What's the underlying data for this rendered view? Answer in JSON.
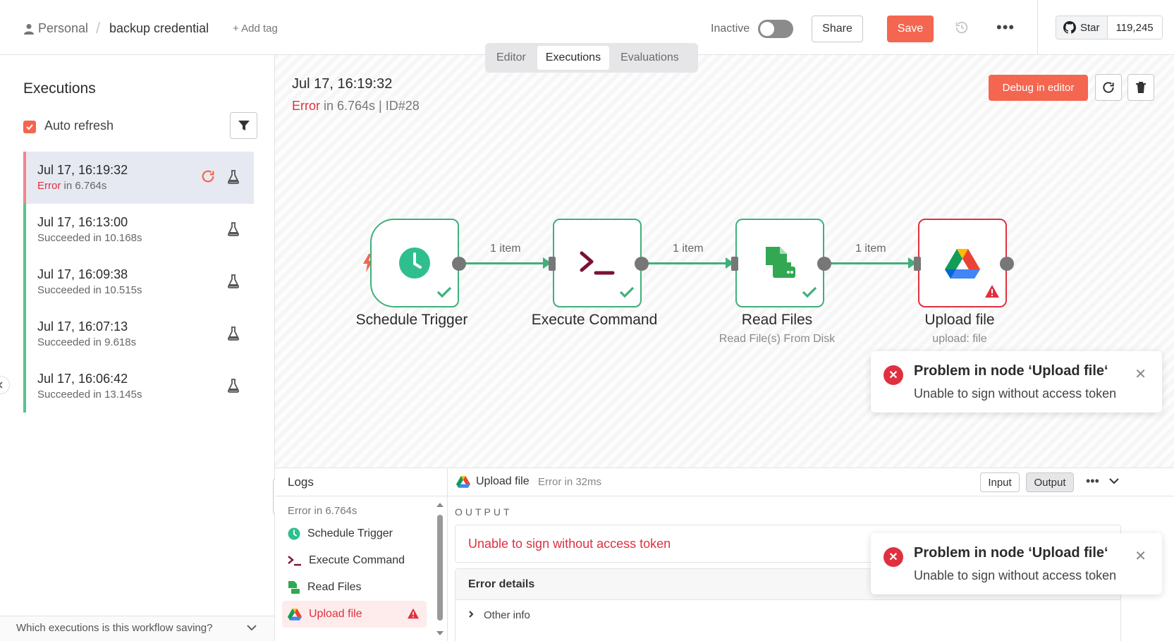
{
  "header": {
    "breadcrumb_owner": "Personal",
    "breadcrumb_sep": "/",
    "workflow_name": "backup credential",
    "add_tag": "+ Add tag",
    "active_label": "Inactive",
    "share_label": "Share",
    "save_label": "Save",
    "more_label": "•••",
    "github_star_label": "Star",
    "github_star_count": "119,245"
  },
  "tabs": [
    {
      "label": "Editor"
    },
    {
      "label": "Executions"
    },
    {
      "label": "Evaluations"
    }
  ],
  "sidebar": {
    "title": "Executions",
    "auto_refresh_label": "Auto refresh",
    "executions": [
      {
        "time": "Jul 17, 16:19:32",
        "status": "Error",
        "duration": " in 6.764s"
      },
      {
        "time": "Jul 17, 16:13:00",
        "status": "Succeeded in 10.168s"
      },
      {
        "time": "Jul 17, 16:09:38",
        "status": "Succeeded in 10.515s"
      },
      {
        "time": "Jul 17, 16:07:13",
        "status": "Succeeded in 9.618s"
      },
      {
        "time": "Jul 17, 16:06:42",
        "status": "Succeeded in 13.145s"
      }
    ],
    "footer_question": "Which executions is this workflow saving?"
  },
  "canvas": {
    "run_time": "Jul 17, 16:19:32",
    "run_status": "Error",
    "run_duration": " in 6.764s | ID#28",
    "debug_label": "Debug in editor",
    "nodes": [
      {
        "name": "Schedule Trigger",
        "subtitle": ""
      },
      {
        "name": "Execute Command",
        "subtitle": ""
      },
      {
        "name": "Read Files",
        "subtitle": "Read File(s) From Disk"
      },
      {
        "name": "Upload file",
        "subtitle": "upload: file"
      }
    ],
    "edges": [
      {
        "label": "1 item"
      },
      {
        "label": "1 item"
      },
      {
        "label": "1 item"
      }
    ]
  },
  "toasts": [
    {
      "title": "Problem in node ‘Upload file‘",
      "message": "Unable to sign without access token"
    },
    {
      "title": "Problem in node ‘Upload file‘",
      "message": "Unable to sign without access token"
    }
  ],
  "logs": {
    "title": "Logs",
    "summary": "Error in 6.764s",
    "items": [
      {
        "label": "Schedule Trigger"
      },
      {
        "label": "Execute Command"
      },
      {
        "label": "Read Files"
      },
      {
        "label": "Upload file"
      }
    ],
    "selected_node": "Upload file",
    "selected_status": "Error in 32ms",
    "input_label": "Input",
    "output_label": "Output",
    "output_heading": "OUTPUT",
    "error_message": "Unable to sign without access token",
    "error_details_label": "Error details",
    "other_info_label": "Other info"
  },
  "colors": {
    "accent": "#f4664f",
    "success": "#3fb07a",
    "error": "#e0303f"
  }
}
